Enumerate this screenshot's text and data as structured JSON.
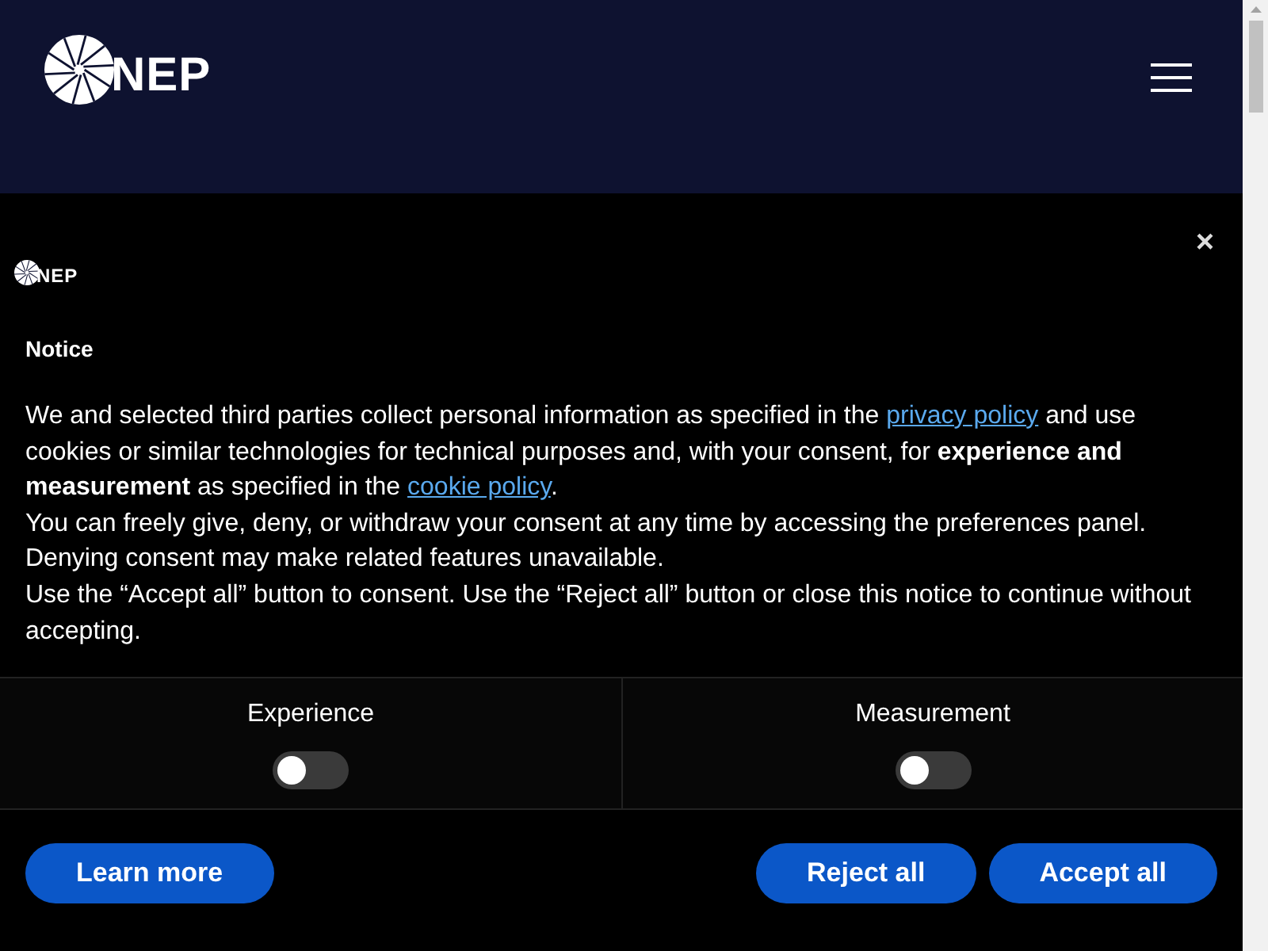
{
  "header": {
    "logo": "NEP"
  },
  "notice": {
    "logo": "NEP",
    "close": "×",
    "title": "Notice",
    "paragraphs": [
      [
        {
          "kind": "text",
          "text": "We and selected third parties collect personal information as specified in the "
        },
        {
          "kind": "link",
          "text": "privacy policy"
        },
        {
          "kind": "text",
          "text": " and use cookies or similar technologies for technical purposes and, with your consent, for **experience and measurement** as specified in the "
        },
        {
          "kind": "link",
          "text": "cookie policy"
        },
        {
          "kind": "text",
          "text": "."
        }
      ],
      [
        {
          "kind": "text",
          "text": "You can freely give, deny, or withdraw your consent at any time by accessing the preferences panel. Denying consent may make related features unavailable."
        }
      ],
      [
        {
          "kind": "text",
          "text": "Use the “Accept all” button to consent. Use the “Reject all” button or close this notice to continue without accepting."
        }
      ]
    ],
    "toggles": [
      {
        "label": "Experience",
        "on": false
      },
      {
        "label": "Measurement",
        "on": false
      }
    ],
    "buttons_left": [
      "Learn more"
    ],
    "buttons_right": [
      "Reject all",
      "Accept all"
    ]
  }
}
